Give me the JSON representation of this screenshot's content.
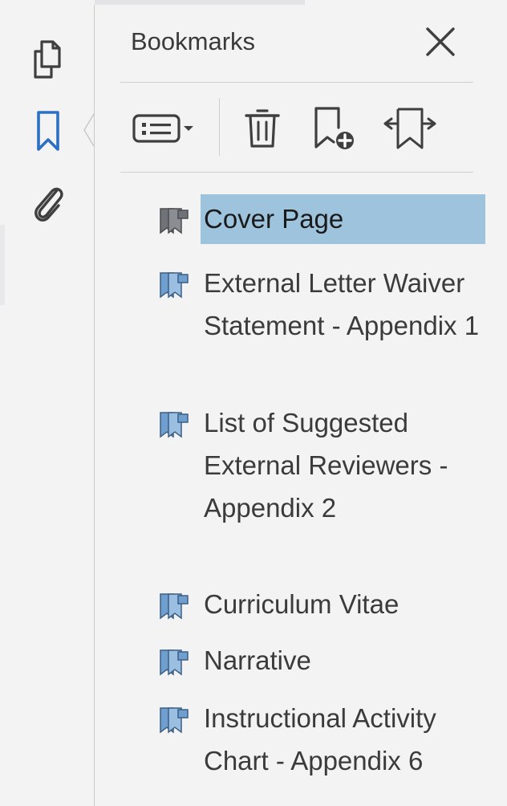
{
  "panel": {
    "title": "Bookmarks",
    "close_label": "×"
  },
  "rail": {
    "items": [
      {
        "name": "pages-icon",
        "active": false
      },
      {
        "name": "bookmark-icon",
        "active": true
      },
      {
        "name": "attachment-icon",
        "active": false
      }
    ]
  },
  "toolbar": {
    "options_icon": "list-options-icon",
    "delete_icon": "trash-icon",
    "new_bookmark_icon": "new-bookmark-icon",
    "expand_icon": "expand-bookmark-icon"
  },
  "bookmarks": [
    {
      "label": "Cover Page",
      "selected": true,
      "icon_color": "#6f7276"
    },
    {
      "label": "External Letter Waiver Statement - Appendix 1",
      "selected": false,
      "icon_color": "#6f9fcf"
    },
    {
      "label": "List of Suggested External Reviewers - Appendix 2",
      "selected": false,
      "icon_color": "#6f9fcf"
    },
    {
      "label": "Curriculum Vitae",
      "selected": false,
      "icon_color": "#6f9fcf"
    },
    {
      "label": "Narrative",
      "selected": false,
      "icon_color": "#6f9fcf"
    },
    {
      "label": "Instructional Activity Chart - Appendix 6",
      "selected": false,
      "icon_color": "#6f9fcf"
    }
  ],
  "colors": {
    "accent": "#2d6fc3",
    "selection": "#9ec3dd",
    "text": "#3b3b3b"
  }
}
